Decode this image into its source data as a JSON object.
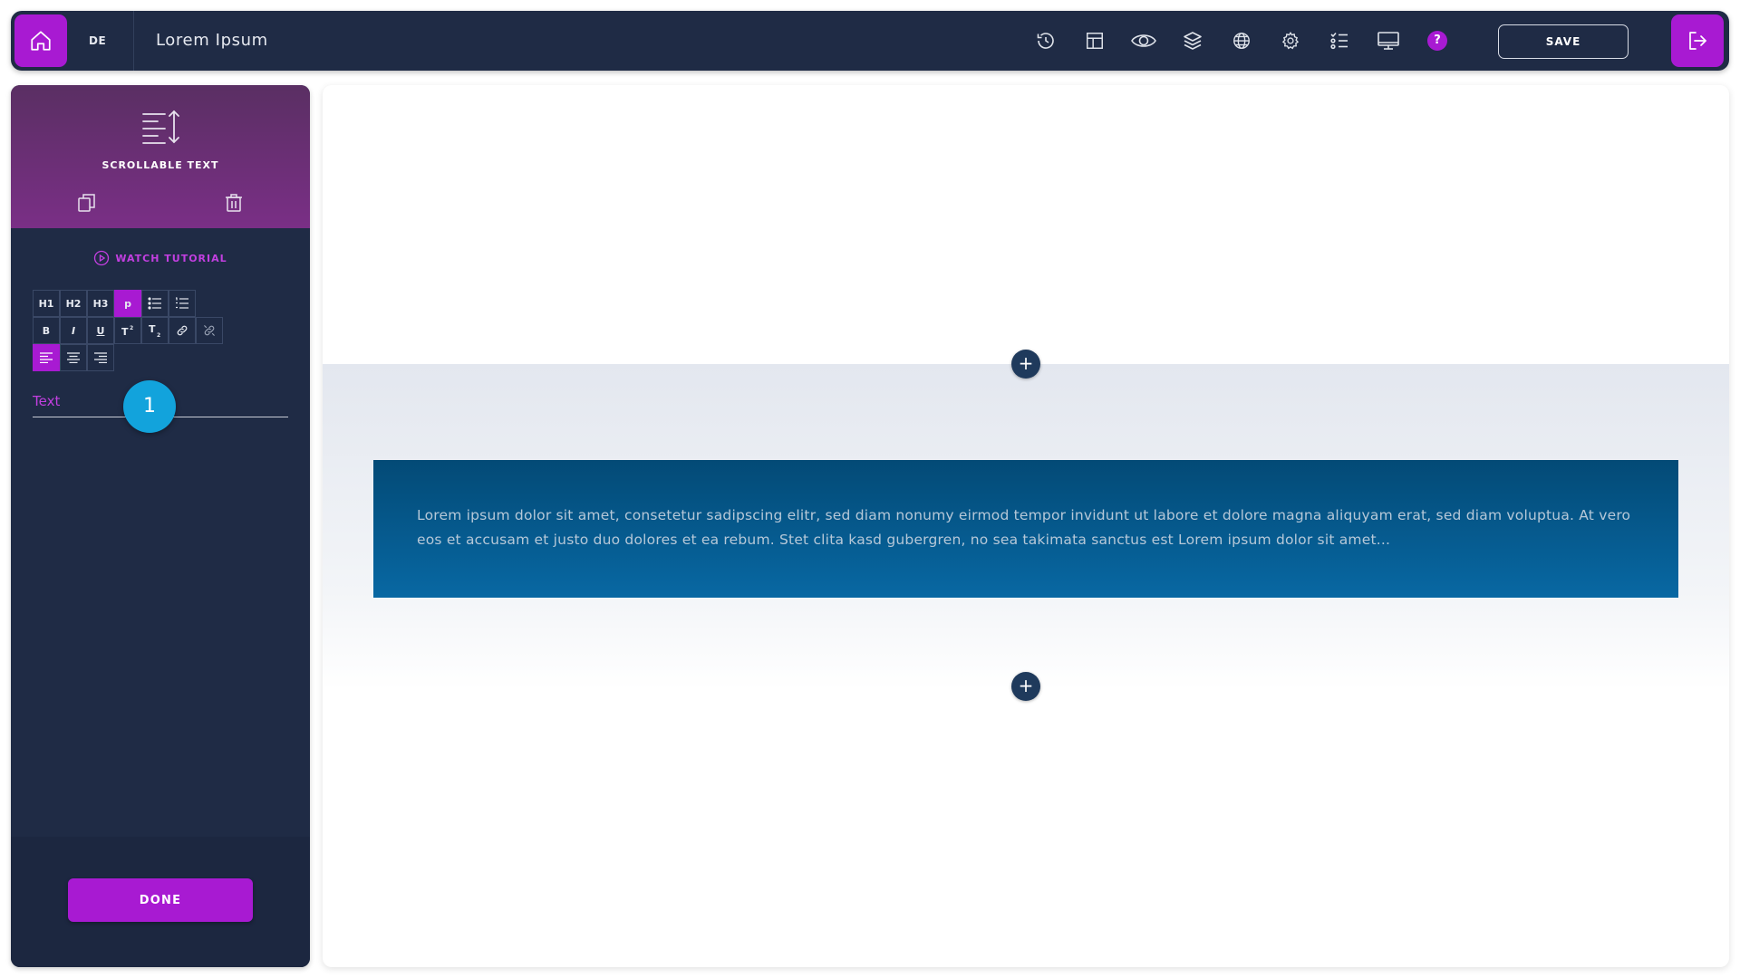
{
  "topbar": {
    "language": "DE",
    "title": "Lorem Ipsum",
    "tools": [
      "history-icon",
      "layout-icon",
      "eye-icon",
      "layers-icon",
      "globe-icon",
      "gear-icon",
      "checklist-icon",
      "desktop-icon",
      "help-icon"
    ],
    "help_label": "?",
    "save_label": "SAVE"
  },
  "sidebar": {
    "element_label": "SCROLLABLE TEXT",
    "tutorial_label": "WATCH TUTORIAL",
    "format_row1": [
      "H1",
      "H2",
      "H3",
      "p"
    ],
    "format_row2": [
      "B",
      "I",
      "U"
    ],
    "active_format": "p",
    "active_alignment": "left",
    "field_label": "Text",
    "step_badge": "1",
    "done_label": "DONE"
  },
  "canvas": {
    "text": "Lorem ipsum dolor sit amet, consetetur sadipscing elitr, sed diam nonumy eirmod tempor invidunt ut labore et dolore magna aliquyam erat, sed diam voluptua. At vero eos et accusam et justo duo dolores et ea rebum. Stet clita kasd gubergren, no sea takimata sanctus est Lorem ipsum dolor sit amet..."
  },
  "colors": {
    "accent": "#a81ad2",
    "topbar_bg": "#1f2b45",
    "text_block_bg": "#0868a3",
    "badge": "#12a3dc"
  }
}
